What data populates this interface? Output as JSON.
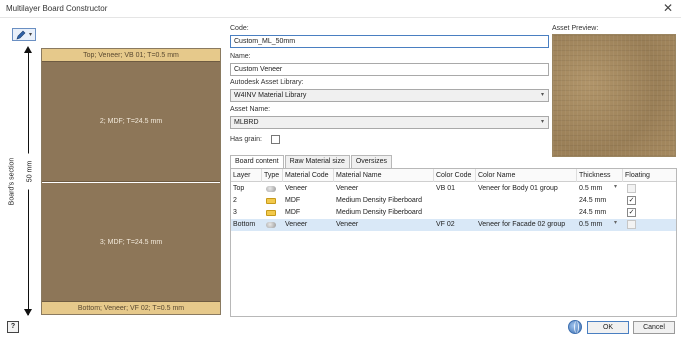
{
  "window": {
    "title": "Multilayer Board Constructor",
    "close_glyph": "✕"
  },
  "toolbar": {
    "tool_icon": "pen-icon",
    "caret": "▾"
  },
  "board": {
    "section_label": "Board's section",
    "dimension_label": "50 mm",
    "layers": [
      {
        "text": "Top; Veneer; VB 01; T=0.5 mm"
      },
      {
        "text": "2; MDF; T=24.5 mm"
      },
      {
        "text": "3; MDF; T=24.5 mm"
      },
      {
        "text": "Bottom; Veneer; VF 02; T=0.5 mm"
      }
    ]
  },
  "form": {
    "code_label": "Code:",
    "code_value": "Custom_ML_50mm",
    "name_label": "Name:",
    "name_value": "Custom Veneer",
    "library_label": "Autodesk Asset Library:",
    "library_value": "W4INV Material Library",
    "asset_name_label": "Asset Name:",
    "asset_name_value": "MLBRD",
    "has_grain_label": "Has grain:",
    "preview_label": "Asset Preview:"
  },
  "tabs": [
    "Board content",
    "Raw Material size",
    "Oversizes"
  ],
  "grid": {
    "columns": [
      "Layer",
      "Type",
      "Material Code",
      "Material Name",
      "Color Code",
      "Color Name",
      "Thickness",
      "Floating"
    ],
    "rows": [
      {
        "layer": "Top",
        "type": "veneer",
        "material_code": "Veneer",
        "material_name": "Veneer",
        "color_code": "VB 01",
        "color_name": "Veneer for Body 01 group",
        "thickness": "0.5 mm",
        "has_dropdown": true,
        "floating": false,
        "floating_disabled": true
      },
      {
        "layer": "2",
        "type": "mdf",
        "material_code": "MDF",
        "material_name": "Medium Density Fiberboard",
        "color_code": "",
        "color_name": "",
        "thickness": "24.5 mm",
        "has_dropdown": false,
        "floating": true,
        "floating_disabled": false
      },
      {
        "layer": "3",
        "type": "mdf",
        "material_code": "MDF",
        "material_name": "Medium Density Fiberboard",
        "color_code": "",
        "color_name": "",
        "thickness": "24.5 mm",
        "has_dropdown": false,
        "floating": true,
        "floating_disabled": false
      },
      {
        "layer": "Bottom",
        "type": "veneer",
        "material_code": "Veneer",
        "material_name": "Veneer",
        "color_code": "VF 02",
        "color_name": "Veneer for Facade 02 group",
        "thickness": "0.5 mm",
        "has_dropdown": true,
        "floating": false,
        "floating_disabled": true
      }
    ]
  },
  "buttons": {
    "ok": "OK",
    "cancel": "Cancel",
    "help": "?"
  }
}
